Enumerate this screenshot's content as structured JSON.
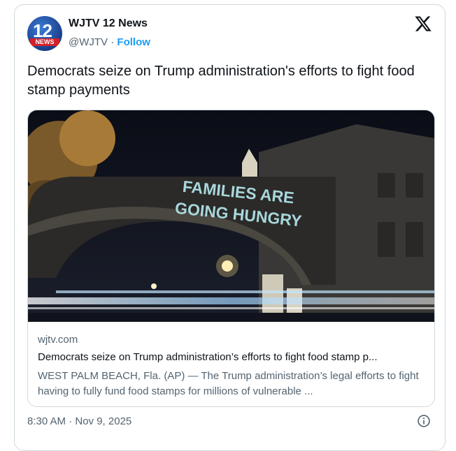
{
  "author": {
    "avatar_number": "12",
    "avatar_banner": "NEWS",
    "name": "WJTV 12 News",
    "handle": "@WJTV",
    "separator": "·",
    "follow_label": "Follow"
  },
  "tweet": {
    "text": "Democrats seize on Trump administration's efforts to fight food stamp payments"
  },
  "link_card": {
    "image_text_line1": "FAMILIES ARE",
    "image_text_line2": "GOING HUNGRY",
    "domain": "wjtv.com",
    "title": "Democrats seize on Trump administration’s efforts to fight food stamp p...",
    "description": "WEST PALM BEACH, Fla. (AP) — The Trump administration’s legal efforts to fight having to fully fund food stamps for millions of vulnerable ..."
  },
  "meta": {
    "timestamp": "8:30 AM · Nov 9, 2025"
  },
  "icons": {
    "platform": "x-logo-icon",
    "info": "info-icon"
  },
  "colors": {
    "link_blue": "#1d9bf0",
    "secondary_text": "#536471",
    "border": "#cfd9de"
  }
}
